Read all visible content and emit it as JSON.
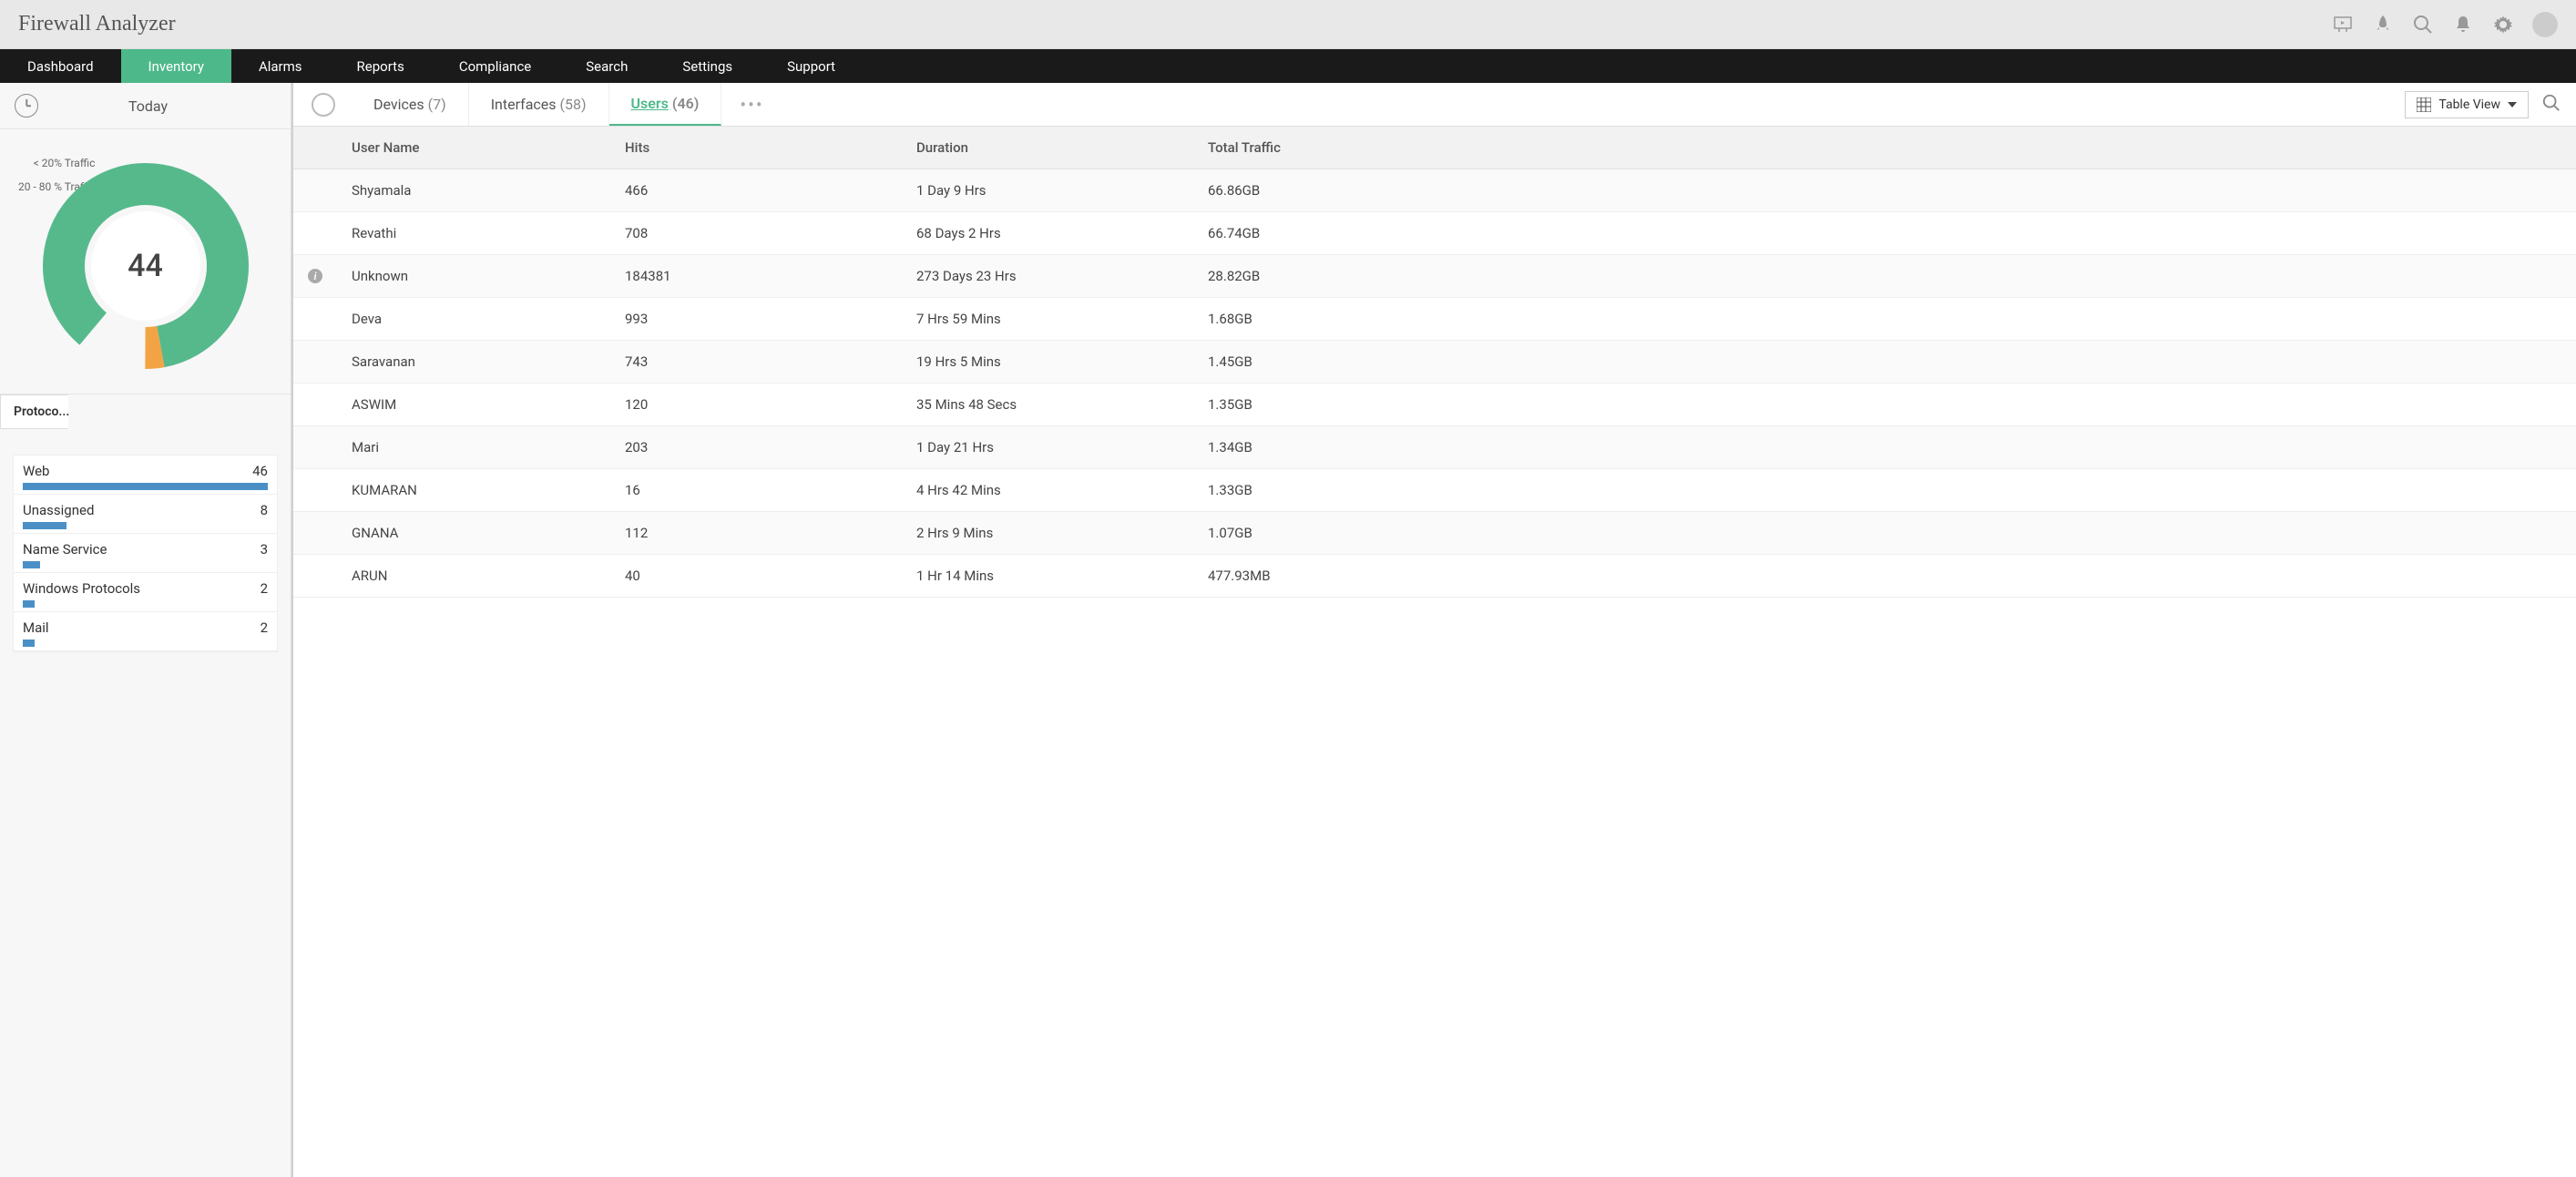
{
  "app_title": "Firewall Analyzer",
  "nav": {
    "items": [
      "Dashboard",
      "Inventory",
      "Alarms",
      "Reports",
      "Compliance",
      "Search",
      "Settings",
      "Support"
    ],
    "active_index": 1
  },
  "sidebar": {
    "date_label": "Today",
    "donut": {
      "center_value": "44",
      "legend": [
        "< 20% Traffic",
        "20 - 80 % Traffic"
      ]
    },
    "section_title": "Protoco...",
    "protocols": [
      {
        "name": "Web",
        "count": "46",
        "bar_pct": 100
      },
      {
        "name": "Unassigned",
        "count": "8",
        "bar_pct": 18
      },
      {
        "name": "Name Service",
        "count": "3",
        "bar_pct": 7
      },
      {
        "name": "Windows Protocols",
        "count": "2",
        "bar_pct": 5
      },
      {
        "name": "Mail",
        "count": "2",
        "bar_pct": 5
      }
    ]
  },
  "main": {
    "tabs": [
      {
        "name": "Devices",
        "count": "(7)"
      },
      {
        "name": "Interfaces",
        "count": "(58)"
      },
      {
        "name": "Users",
        "count": "(46)"
      }
    ],
    "active_tab_index": 2,
    "view_label": "Table View",
    "columns": [
      "User Name",
      "Hits",
      "Duration",
      "Total Traffic"
    ],
    "rows": [
      {
        "user": "Shyamala",
        "hits": "466",
        "duration": "1 Day 9 Hrs",
        "traffic": "66.86GB",
        "info": false
      },
      {
        "user": "Revathi",
        "hits": "708",
        "duration": "68 Days 2 Hrs",
        "traffic": "66.74GB",
        "info": false
      },
      {
        "user": "Unknown",
        "hits": "184381",
        "duration": "273 Days 23 Hrs",
        "traffic": "28.82GB",
        "info": true
      },
      {
        "user": "Deva",
        "hits": "993",
        "duration": "7 Hrs 59 Mins",
        "traffic": "1.68GB",
        "info": false
      },
      {
        "user": "Saravanan",
        "hits": "743",
        "duration": "19 Hrs 5 Mins",
        "traffic": "1.45GB",
        "info": false
      },
      {
        "user": "ASWIM",
        "hits": "120",
        "duration": "35 Mins 48 Secs",
        "traffic": "1.35GB",
        "info": false
      },
      {
        "user": "Mari",
        "hits": "203",
        "duration": "1 Day 21 Hrs",
        "traffic": "1.34GB",
        "info": false
      },
      {
        "user": "KUMARAN",
        "hits": "16",
        "duration": "4 Hrs 42 Mins",
        "traffic": "1.33GB",
        "info": false
      },
      {
        "user": "GNANA",
        "hits": "112",
        "duration": "2 Hrs 9 Mins",
        "traffic": "1.07GB",
        "info": false
      },
      {
        "user": "ARUN",
        "hits": "40",
        "duration": "1 Hr 14 Mins",
        "traffic": "477.93MB",
        "info": false
      }
    ]
  },
  "chart_data": {
    "type": "pie",
    "title": "",
    "center_label": "44",
    "series": [
      {
        "name": "< 20% Traffic",
        "value": 86,
        "color": "#56b98c"
      },
      {
        "name": "20 - 80 % Traffic",
        "value": 3,
        "color": "#f2a444"
      },
      {
        "name": "gap",
        "value": 11,
        "color": "transparent"
      }
    ],
    "notes": "Donut gauge. Angles estimated from screenshot. Green arc ~310°, orange ~11°, remaining gap ~39°."
  }
}
